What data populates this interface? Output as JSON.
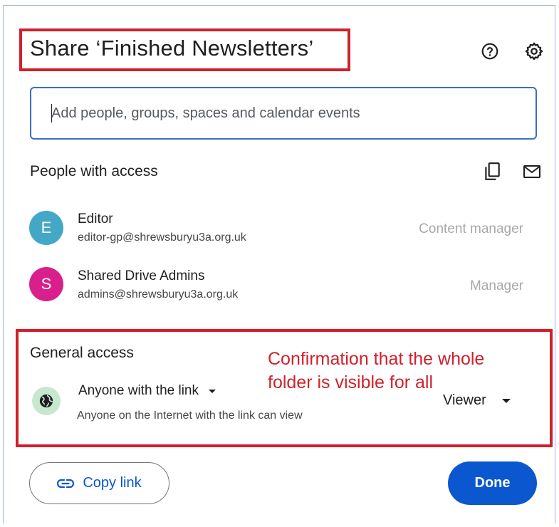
{
  "dialog": {
    "title": "Share ‘Finished Newsletters’",
    "help_icon": "help-circle-icon",
    "settings_icon": "gear-icon"
  },
  "search": {
    "placeholder": "Add people, groups, spaces and calendar events",
    "value": ""
  },
  "people_section": {
    "title": "People with access",
    "copy_emails_icon": "copy-icon",
    "email_icon": "mail-icon",
    "people": [
      {
        "initial": "E",
        "name": "Editor",
        "email": "editor-gp@shrewsburyu3a.org.uk",
        "role": "Content manager",
        "avatar_color": "#43a8c6"
      },
      {
        "initial": "S",
        "name": "Shared Drive Admins",
        "email": "admins@shrewsburyu3a.org.uk",
        "role": "Manager",
        "avatar_color": "#d81f8c"
      }
    ]
  },
  "general_access": {
    "title": "General access",
    "link_setting": "Anyone with the link",
    "description": "Anyone on the Internet with the link can view",
    "role": "Viewer",
    "globe_icon": "globe-icon"
  },
  "annotation": {
    "text": "Confirmation that the whole folder is visible for all",
    "color": "#d0212b"
  },
  "footer": {
    "copy_link_label": "Copy link",
    "done_label": "Done",
    "accent": "#0b57d0"
  }
}
